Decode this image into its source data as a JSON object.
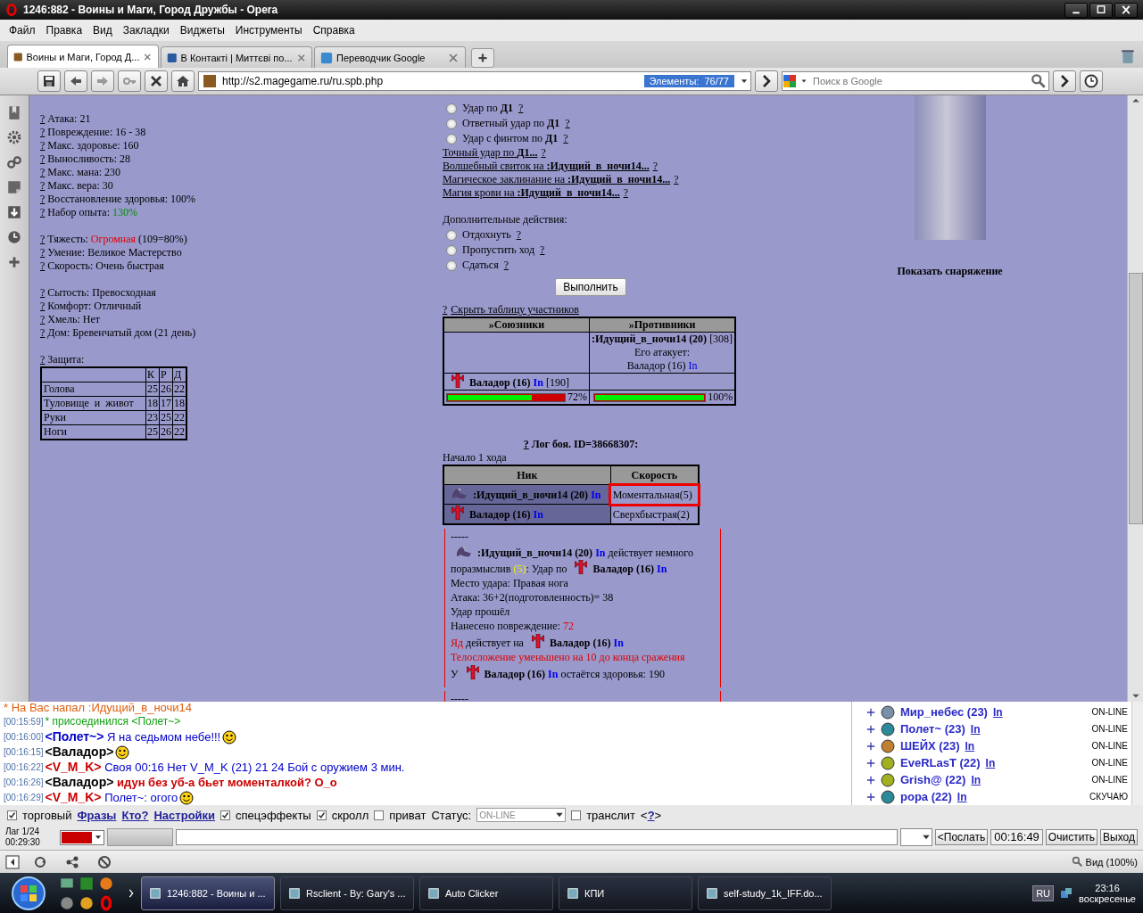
{
  "window": {
    "title": "1246:882 - Воины и Маги, Город Дружбы - Opera"
  },
  "menu": [
    "Файл",
    "Правка",
    "Вид",
    "Закладки",
    "Виджеты",
    "Инструменты",
    "Справка"
  ],
  "tabs": [
    {
      "label": "Воины и Маги, Город Д...",
      "selected": true
    },
    {
      "label": "В Контакті | Миттєві по...",
      "selected": false
    },
    {
      "label": "Переводчик Google",
      "selected": false
    }
  ],
  "address_bar": {
    "url": "http://s2.magegame.ru/ru.spb.php",
    "elements_badge": "Элементы:  76/77",
    "search_placeholder": "Поиск в Google"
  },
  "stats": [
    [
      [
        {
          "kind": "help",
          "text": "?"
        },
        {
          "kind": "text",
          "text": " Атака: 21"
        }
      ],
      [
        {
          "kind": "help",
          "text": "?"
        },
        {
          "kind": "text",
          "text": " Повреждение: 16 - 38"
        }
      ],
      [
        {
          "kind": "help",
          "text": "?"
        },
        {
          "kind": "text",
          "text": " Макс. здоровье: 160"
        }
      ],
      [
        {
          "kind": "help",
          "text": "?"
        },
        {
          "kind": "text",
          "text": " Выносливость: 28"
        }
      ],
      [
        {
          "kind": "help",
          "text": "?"
        },
        {
          "kind": "text",
          "text": " Макс. мана: 230"
        }
      ],
      [
        {
          "kind": "help",
          "text": "?"
        },
        {
          "kind": "text",
          "text": " Макс. вера: 30"
        }
      ],
      [
        {
          "kind": "help",
          "text": "?"
        },
        {
          "kind": "text",
          "text": " Восстановление здоровья: 100%"
        }
      ],
      [
        {
          "kind": "help",
          "text": "?"
        },
        {
          "kind": "text",
          "text": " Набор опыта: "
        },
        {
          "kind": "green",
          "text": "130%"
        }
      ]
    ],
    [
      [
        {
          "kind": "help",
          "text": "?"
        },
        {
          "kind": "text",
          "text": " Тяжесть: "
        },
        {
          "kind": "red",
          "text": "Огромная"
        },
        {
          "kind": "text",
          "text": " (109=80%)"
        }
      ],
      [
        {
          "kind": "help",
          "text": "?"
        },
        {
          "kind": "text",
          "text": " Умение: Великое Мастерство"
        }
      ],
      [
        {
          "kind": "help",
          "text": "?"
        },
        {
          "kind": "text",
          "text": " Скорость: Очень быстрая"
        }
      ]
    ],
    [
      [
        {
          "kind": "help",
          "text": "?"
        },
        {
          "kind": "text",
          "text": " Сытость: Превосходная"
        }
      ],
      [
        {
          "kind": "help",
          "text": "?"
        },
        {
          "kind": "text",
          "text": " Комфорт: Отличный"
        }
      ],
      [
        {
          "kind": "help",
          "text": "?"
        },
        {
          "kind": "text",
          "text": " Хмель: Нет"
        }
      ],
      [
        {
          "kind": "help",
          "text": "?"
        },
        {
          "kind": "text",
          "text": " Дом: Бревенчатый дом (21 день)"
        }
      ]
    ]
  ],
  "defense": {
    "title": [
      {
        "kind": "help",
        "text": "?"
      },
      {
        "kind": "text",
        "text": " Защита:"
      }
    ],
    "columns": [
      "К",
      "Р",
      "Д"
    ],
    "rows": [
      {
        "part": "Голова",
        "values": [
          "25",
          "26",
          "22"
        ]
      },
      {
        "part": "Туловище  и  живот",
        "values": [
          "18",
          "17",
          "18"
        ]
      },
      {
        "part": "Руки",
        "values": [
          "23",
          "25",
          "22"
        ]
      },
      {
        "part": "Ноги",
        "values": [
          "25",
          "26",
          "22"
        ]
      }
    ]
  },
  "actions": {
    "items": [
      {
        "kind": "radio",
        "label": "Удар по **Д1**",
        "help": "?",
        "selected": false
      },
      {
        "kind": "radio",
        "label": "Ответный удар по **Д1**",
        "help": "?",
        "selected": false
      },
      {
        "kind": "radio",
        "label": "Удар с финтом по **Д1**",
        "help": "?",
        "selected": false
      },
      {
        "kind": "link",
        "label": "Точный удар по **Д1...**",
        "help": "?"
      },
      {
        "kind": "link",
        "label": "Волшебный свиток на **:Идущий_в_ночи14...**",
        "help": "?"
      },
      {
        "kind": "link",
        "label": "Магическое заклинание на **:Идущий_в_ночи14...**",
        "help": "?"
      },
      {
        "kind": "link",
        "label": "Магия крови на **:Идущий_в_ночи14...**",
        "help": "?"
      }
    ],
    "extra_label": "Дополнительные действия:",
    "extra": [
      {
        "label": "Отдохнуть",
        "help": "?",
        "selected": false
      },
      {
        "label": "Пропустить ход",
        "help": "?",
        "selected": false
      },
      {
        "label": "Сдаться",
        "help": "?",
        "selected": false
      }
    ],
    "submit": "Выполнить"
  },
  "participants": {
    "help": "?",
    "toggle": "Скрыть таблицу участников",
    "allies_header": "»Союзники",
    "enemies_header": "»Противники",
    "enemy": {
      "name": ":Идущий_в_ночи14 (20)",
      "hp": " [308]",
      "attacked_by_label": "Его атакует:",
      "attacker": "Валадор (16) ",
      "attacker_link": "In"
    },
    "ally": {
      "name": "Валадор (16) ",
      "link": "In",
      "hp": " [190]"
    },
    "ally_health": {
      "level": 0.72,
      "reading": "72%"
    },
    "enemy_health": {
      "level": 1,
      "reading": "100%"
    }
  },
  "battle_log": {
    "help": "?",
    "title": " Лог боя. ID=38668307:",
    "turn": "Начало 1 хода",
    "columns": [
      "Ник",
      "Скорость"
    ],
    "rows": [
      {
        "kind": "monster",
        "name": ":Идущий_в_ночи14 (20) ",
        "link": "In",
        "speed": "Моментальная(5)",
        "highlighted": true
      },
      {
        "kind": "player",
        "name": "Валадор (16) ",
        "link": "In",
        "speed": "Сверхбыстрая(2)",
        "highlighted": false
      }
    ],
    "entries": [
      [
        [
          {
            "kind": "text",
            "text": "-----"
          }
        ],
        [
          {
            "kind": "creature"
          },
          {
            "kind": "bold",
            "text": ":Идущий_в_ночи14 (20) "
          },
          {
            "kind": "in",
            "text": "In"
          },
          {
            "kind": "text",
            "text": " действует немного поразмыслив "
          },
          {
            "kind": "yellow",
            "text": "(5)"
          },
          {
            "kind": "text",
            "text": ": Удар по "
          },
          {
            "kind": "cross"
          },
          {
            "kind": "bold",
            "text": "Валадор (16) "
          },
          {
            "kind": "in",
            "text": "In"
          }
        ],
        [
          {
            "kind": "text",
            "text": "Место удара: Правая нога"
          }
        ],
        [
          {
            "kind": "text",
            "text": "Атака: 36+2(подготовленность)= 38"
          }
        ],
        [
          {
            "kind": "text",
            "text": "Удар прошёл"
          }
        ],
        [
          {
            "kind": "text",
            "text": "Нанесено повреждение: "
          },
          {
            "kind": "red",
            "text": "72"
          }
        ],
        [
          {
            "kind": "red",
            "text": "Яд"
          },
          {
            "kind": "text",
            "text": " действует на "
          },
          {
            "kind": "cross"
          },
          {
            "kind": "bold",
            "text": "Валадор (16) "
          },
          {
            "kind": "in",
            "text": "In"
          }
        ],
        [
          {
            "kind": "red",
            "text": "Телосложение уменьшено на 10 до конца сражения"
          }
        ],
        [
          {
            "kind": "text",
            "text": "У "
          },
          {
            "kind": "cross"
          },
          {
            "kind": "bold",
            "text": "Валадор (16) "
          },
          {
            "kind": "in",
            "text": "In"
          },
          {
            "kind": "text",
            "text": " остаётся здоровья: 190"
          }
        ]
      ],
      [
        [
          {
            "kind": "text",
            "text": "-----"
          }
        ]
      ]
    ]
  },
  "equipment": {
    "link": "Показать снаряжение"
  },
  "chat": {
    "messages": [
      {
        "kind": "alert",
        "text": "* На Вас напал :Идущий_в_ночи14"
      },
      {
        "kind": "join",
        "time": "[00:15:59]",
        "text": "* присоединился <Полет~>"
      },
      {
        "kind": "say",
        "time": "[00:16:00]",
        "nick": "<Полет~>",
        "color": "#0000cc",
        "text": " Я на седьмом небе!!!",
        "smiley": true
      },
      {
        "kind": "say",
        "time": "[00:16:15]",
        "nick": "<Валадор>",
        "color": "#000000",
        "smiley": true
      },
      {
        "kind": "say",
        "time": "[00:16:22]",
        "nick": "<V_M_K>",
        "color": "#cc0000",
        "text": " Своя 00:16 Нет V_M_K (21) 21 24 Бой с оружием 3 мин.",
        "smiley": false
      },
      {
        "kind": "shout",
        "time": "[00:16:26]",
        "nick": "<Валадор>",
        "color": "#000000",
        "text": " идун без уб-а бьет моменталкой? О_о",
        "smiley": false
      },
      {
        "kind": "say",
        "time": "[00:16:29]",
        "nick": "<V_M_K>",
        "color": "#cc0000",
        "text": " Полет~: огого",
        "smiley": true
      }
    ],
    "users": [
      {
        "name": "Мир_небес (23)",
        "link": "In",
        "status": "ON-LINE",
        "color": "#7a8fa8"
      },
      {
        "name": "Полет~ (23)",
        "link": "In",
        "status": "ON-LINE",
        "color": "#2a8a9a"
      },
      {
        "name": "ШЕЙХ (23)",
        "link": "In",
        "status": "ON-LINE",
        "color": "#c08030"
      },
      {
        "name": "EveRLasT (22)",
        "link": "In",
        "status": "ON-LINE",
        "color": "#a0b020"
      },
      {
        "name": "Grish@ (22)",
        "link": "In",
        "status": "ON-LINE",
        "color": "#a0b020"
      },
      {
        "name": "popa (22)",
        "link": "In",
        "status": "СКУЧАЮ",
        "color": "#2a8a9a"
      }
    ],
    "options": [
      {
        "kind": "checkbox",
        "label": "торговый",
        "checked": true
      },
      {
        "kind": "link",
        "label": "Фразы"
      },
      {
        "kind": "link",
        "label": "Кто?"
      },
      {
        "kind": "link",
        "label": "Настройки"
      },
      {
        "kind": "checkbox",
        "label": "спецэффекты",
        "checked": true
      },
      {
        "kind": "checkbox",
        "label": "скролл",
        "checked": true
      },
      {
        "kind": "checkbox",
        "label": "приват",
        "checked": false
      },
      {
        "kind": "select",
        "label": "Статус:",
        "value": "ON-LINE"
      },
      {
        "kind": "checkbox",
        "label": "транслит",
        "checked": false
      },
      {
        "kind": "help",
        "before": "<",
        "label": "?",
        "after": ">"
      }
    ],
    "lag": "Лаг 1/24",
    "session_time": "00:29:30",
    "send": "<Послать",
    "clock": "00:16:49",
    "clear": "Очистить",
    "exit": "Выход"
  },
  "status_bar": {
    "zoom": "Вид (100%)"
  },
  "taskbar": {
    "tasks": [
      {
        "label": "1246:882 - Воины и ...",
        "selected": true
      },
      {
        "label": "Rsclient - By: Gary's ...",
        "selected": false
      },
      {
        "label": "Auto Clicker",
        "selected": false
      },
      {
        "label": "КПИ",
        "selected": false
      },
      {
        "label": "self-study_1k_IFF.do...",
        "selected": false
      }
    ],
    "language": "RU",
    "time": "23:16",
    "day": "воскресенье"
  }
}
